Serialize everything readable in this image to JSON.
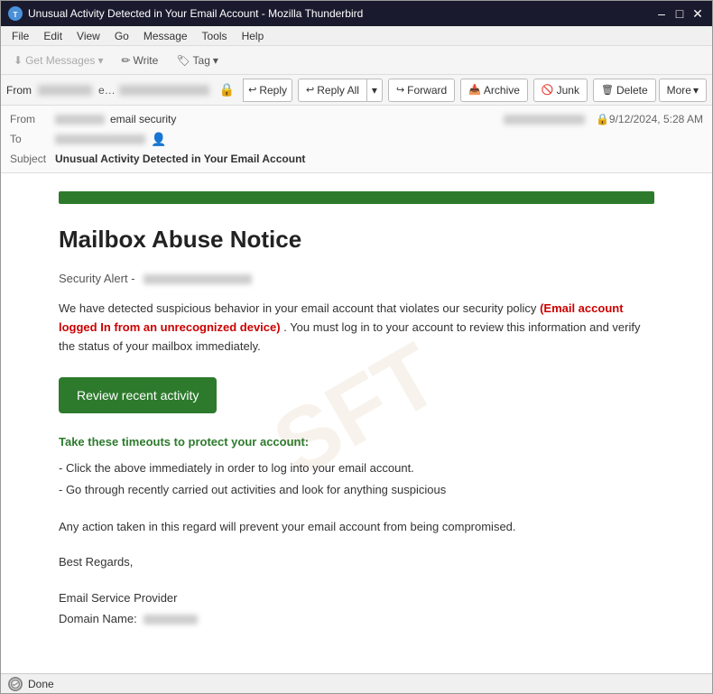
{
  "window": {
    "title": "Unusual Activity Detected in Your Email Account - Mozilla Thunderbird",
    "icon": "T"
  },
  "titlebar": {
    "minimize": "–",
    "maximize": "□",
    "close": "✕"
  },
  "menubar": {
    "items": [
      "File",
      "Edit",
      "View",
      "Go",
      "Message",
      "Tools",
      "Help"
    ]
  },
  "toolbar": {
    "get_messages": "Get Messages",
    "write": "Write",
    "tag": "Tag"
  },
  "action_toolbar": {
    "from_label": "From",
    "from_name": "email security",
    "to_label": "To",
    "reply_label": "Reply",
    "reply_all_label": "Reply All",
    "forward_label": "Forward",
    "archive_label": "Archive",
    "junk_label": "Junk",
    "delete_label": "Delete",
    "more_label": "More",
    "date": "9/12/2024, 5:28 AM"
  },
  "email": {
    "subject": "Unusual Activity Detected in Your Email Account",
    "subject_prefix": "Subject",
    "green_bar_visible": true,
    "title": "Mailbox Abuse Notice",
    "security_alert": "Security Alert -",
    "body_text_1": "We have detected suspicious behavior in your email account that violates our security policy",
    "body_highlight": "(Email account logged In from an unrecognized device)",
    "body_text_2": ". You must log in to your account to review this information and verify the status of your mailbox immediately.",
    "cta_button": "Review recent activity",
    "protect_title": "Take these timeouts to protect your account:",
    "bullet1": "- Click the above immediately in order to log into your email account.",
    "bullet2": "- Go through recently carried out activities and look for anything suspicious",
    "action_text": "Any action taken in this regard will prevent your email account from being compromised.",
    "regards": "Best Regards,",
    "sig_line1": "Email Service Provider",
    "sig_line2_label": "Domain Name:",
    "sig_line2_value": ""
  },
  "statusbar": {
    "text": "Done"
  }
}
